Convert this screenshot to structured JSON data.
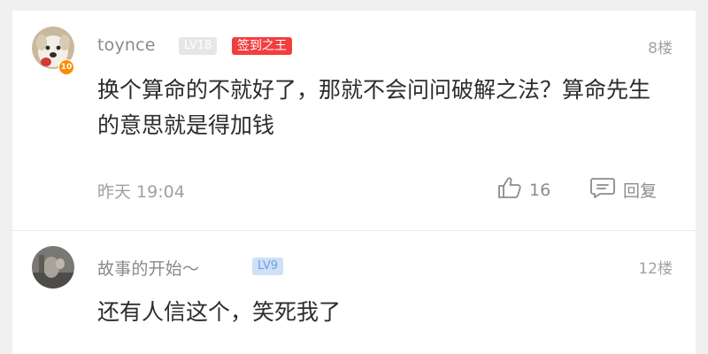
{
  "comments": [
    {
      "username": "toynce",
      "level_badge": "LV18",
      "title_badge": "签到之王",
      "avatar_level": "10",
      "floor": "8楼",
      "text": "换个算命的不就好了，那就不会问问破解之法？算命先生的意思就是得加钱",
      "time": "昨天 19:04",
      "likes": "16",
      "reply_label": "回复"
    },
    {
      "username": "故事的开始～",
      "level_badge": "LV9",
      "floor": "12楼",
      "text": "还有人信这个，笑死我了"
    }
  ],
  "colors": {
    "background": "#f0f0f0",
    "card": "#ffffff",
    "title_badge": "#f23e3e",
    "level_gray": "#e6e6e6",
    "level_blue": "#cfe0f7",
    "avatar_level_dot": "#ff8a00"
  },
  "icons": [
    "thumbs-up-icon",
    "reply-icon"
  ]
}
